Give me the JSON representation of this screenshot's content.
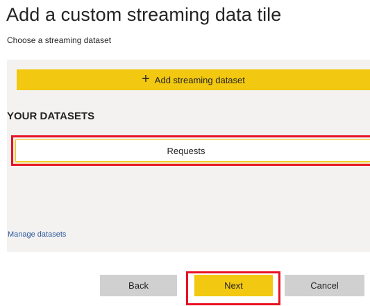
{
  "header": {
    "title": "Add a custom streaming data tile",
    "subtitle": "Choose a streaming dataset"
  },
  "actions": {
    "add_dataset_label": "Add streaming dataset",
    "add_dataset_icon": "plus-icon"
  },
  "datasets": {
    "heading": "YOUR DATASETS",
    "items": [
      {
        "label": "Requests",
        "selected": true
      }
    ],
    "manage_link": "Manage datasets"
  },
  "footer": {
    "back_label": "Back",
    "next_label": "Next",
    "cancel_label": "Cancel"
  },
  "colors": {
    "accent": "#f2c811",
    "highlight": "#e81123",
    "panel_bg": "#f3f2f1",
    "secondary_button": "#d0d0d0",
    "link": "#2b579a"
  }
}
